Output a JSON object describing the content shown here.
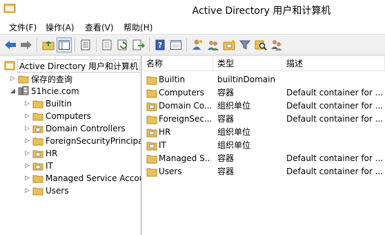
{
  "window": {
    "title": "Active Directory 用户和计算机"
  },
  "menu": [
    "文件(F)",
    "操作(A)",
    "查看(V)",
    "帮助(H)"
  ],
  "toolbar_icons": [
    "back-icon",
    "forward-icon",
    "up-folder-icon",
    "show-tree-icon",
    "properties-icon",
    "export-list-icon",
    "refresh-icon",
    "export-icon",
    "help-icon",
    "console-icon",
    "add-user-icon",
    "add-group-icon",
    "add-ou-icon",
    "filter-icon",
    "find-icon",
    "delegate-icon"
  ],
  "tree": {
    "root": "Active Directory 用户和计算机",
    "saved_queries": "保存的查询",
    "domain": "51hcie.com",
    "children": [
      "Builtin",
      "Computers",
      "Domain Controllers",
      "ForeignSecurityPrincipals",
      "HR",
      "IT",
      "Managed Service Accounts",
      "Users"
    ]
  },
  "list": {
    "columns": [
      "名称",
      "类型",
      "描述"
    ],
    "rows": [
      {
        "name": "Builtin",
        "type": "builtinDomain",
        "desc": "",
        "icon": "builtin-folder-icon"
      },
      {
        "name": "Computers",
        "type": "容器",
        "desc": "Default container for ...",
        "icon": "container-folder-icon"
      },
      {
        "name": "Domain Co...",
        "type": "组织单位",
        "desc": "Default container for ...",
        "icon": "ou-folder-icon"
      },
      {
        "name": "ForeignSec...",
        "type": "容器",
        "desc": "Default container for ...",
        "icon": "container-folder-icon"
      },
      {
        "name": "HR",
        "type": "组织单位",
        "desc": "",
        "icon": "ou-folder-icon"
      },
      {
        "name": "IT",
        "type": "组织单位",
        "desc": "",
        "icon": "ou-folder-icon"
      },
      {
        "name": "Managed S...",
        "type": "容器",
        "desc": "Default container for ...",
        "icon": "container-folder-icon"
      },
      {
        "name": "Users",
        "type": "容器",
        "desc": "Default container for ...",
        "icon": "container-folder-icon"
      }
    ]
  },
  "colors": {
    "folder": "#e8c15c",
    "folder_dark": "#c99a2e",
    "selection_border": "#7da2ce",
    "arrow_blue": "#2f6fbd"
  }
}
